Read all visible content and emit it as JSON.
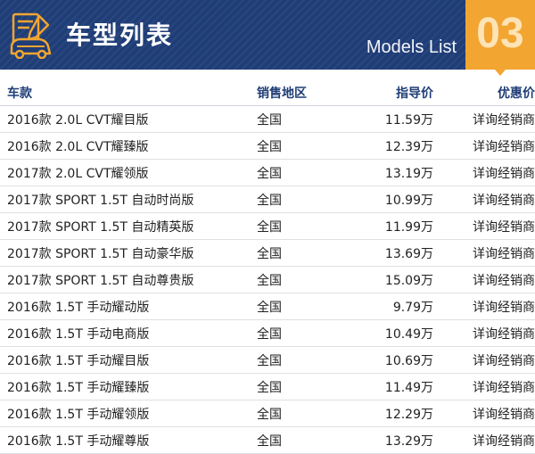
{
  "header": {
    "title": "车型列表",
    "subtitle": "Models List",
    "number": "03"
  },
  "colors": {
    "banner": "#1f3d77",
    "accent": "#f2a531",
    "header_text": "#1f3d77"
  },
  "icons": {
    "logo": "car-certificate-icon"
  },
  "table": {
    "columns": [
      "车款",
      "销售地区",
      "指导价",
      "优惠价"
    ],
    "rows": [
      [
        "2016款 2.0L CVT耀目版",
        "全国",
        "11.59万",
        "详询经销商"
      ],
      [
        "2016款 2.0L CVT耀臻版",
        "全国",
        "12.39万",
        "详询经销商"
      ],
      [
        "2017款 2.0L CVT耀领版",
        "全国",
        "13.19万",
        "详询经销商"
      ],
      [
        "2017款 SPORT 1.5T 自动时尚版",
        "全国",
        "10.99万",
        "详询经销商"
      ],
      [
        "2017款 SPORT 1.5T 自动精英版",
        "全国",
        "11.99万",
        "详询经销商"
      ],
      [
        "2017款 SPORT 1.5T 自动豪华版",
        "全国",
        "13.69万",
        "详询经销商"
      ],
      [
        "2017款 SPORT 1.5T 自动尊贵版",
        "全国",
        "15.09万",
        "详询经销商"
      ],
      [
        "2016款 1.5T 手动耀动版",
        "全国",
        "9.79万",
        "详询经销商"
      ],
      [
        "2016款 1.5T 手动电商版",
        "全国",
        "10.49万",
        "详询经销商"
      ],
      [
        "2016款 1.5T 手动耀目版",
        "全国",
        "10.69万",
        "详询经销商"
      ],
      [
        "2016款 1.5T 手动耀臻版",
        "全国",
        "11.49万",
        "详询经销商"
      ],
      [
        "2016款 1.5T 手动耀领版",
        "全国",
        "12.29万",
        "详询经销商"
      ],
      [
        "2016款 1.5T 手动耀尊版",
        "全国",
        "13.29万",
        "详询经销商"
      ]
    ]
  }
}
